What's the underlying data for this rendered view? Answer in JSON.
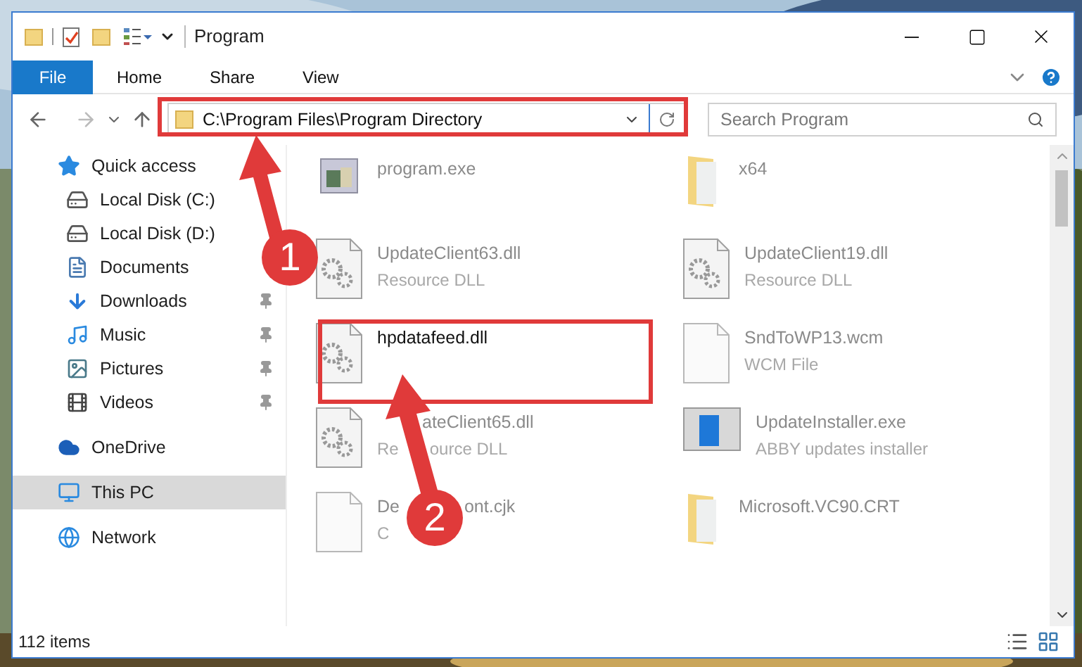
{
  "window": {
    "title": "Program"
  },
  "ribbon_tabs": [
    {
      "label": "File",
      "selected": true
    },
    {
      "label": "Home",
      "selected": false
    },
    {
      "label": "Share",
      "selected": false
    },
    {
      "label": "View",
      "selected": false
    }
  ],
  "address_bar": {
    "value": "C:\\Program Files\\Program Directory"
  },
  "search": {
    "placeholder": "Search Program"
  },
  "sidebar": {
    "items": [
      {
        "label": "Quick access",
        "kind": "quick",
        "selected": false,
        "children": [
          {
            "label": "Local Disk (C:)",
            "kind": "disk-c",
            "pinned": false
          },
          {
            "label": "Local Disk (D:)",
            "kind": "disk",
            "pinned": false
          },
          {
            "label": "Documents",
            "kind": "documents",
            "pinned": false
          },
          {
            "label": "Downloads",
            "kind": "downloads",
            "pinned": true
          },
          {
            "label": "Music",
            "kind": "music",
            "pinned": true
          },
          {
            "label": "Pictures",
            "kind": "pictures",
            "pinned": true
          },
          {
            "label": "Videos",
            "kind": "videos",
            "pinned": true
          }
        ]
      },
      {
        "label": "OneDrive",
        "kind": "cloud",
        "selected": false
      },
      {
        "label": "This PC",
        "kind": "pc",
        "selected": true
      },
      {
        "label": "Network",
        "kind": "network",
        "selected": false
      }
    ]
  },
  "files": [
    {
      "name": "program.exe",
      "kind": "exe",
      "blurred": true
    },
    {
      "name": "x64",
      "kind": "folder",
      "blurred": true
    },
    {
      "name": "UpdateClient63.dll",
      "type": "Resource DLL",
      "kind": "dll",
      "blurred": true
    },
    {
      "name": "UpdateClient19.dll",
      "type": "Resource DLL",
      "kind": "dll",
      "blurred": true
    },
    {
      "name": "hpdatafeed.dll",
      "kind": "dll",
      "blurred": false
    },
    {
      "name": "SndToWP13.wcm",
      "type": "WCM File",
      "kind": "file",
      "blurred": true
    },
    {
      "name_parts": [
        {
          "text": "ateClient65.dll"
        }
      ],
      "type_parts": [
        {
          "text": "Re"
        },
        {
          "text": "ource DLL"
        }
      ],
      "kind": "dll",
      "blurred": true
    },
    {
      "name": "UpdateInstaller.exe",
      "type": "ABBY updates installer",
      "kind": "installer",
      "blurred": true
    },
    {
      "name_parts": [
        {
          "text": "De"
        },
        {
          "text": "ont.cjk"
        }
      ],
      "type_parts": [
        {
          "text": "C"
        }
      ],
      "kind": "file",
      "blurred": true
    },
    {
      "name": "Microsoft.VC90.CRT",
      "kind": "folder",
      "blurred": true
    }
  ],
  "status_bar": {
    "item_count": "112 items"
  },
  "annotations": [
    {
      "label": "1"
    },
    {
      "label": "2"
    }
  ]
}
